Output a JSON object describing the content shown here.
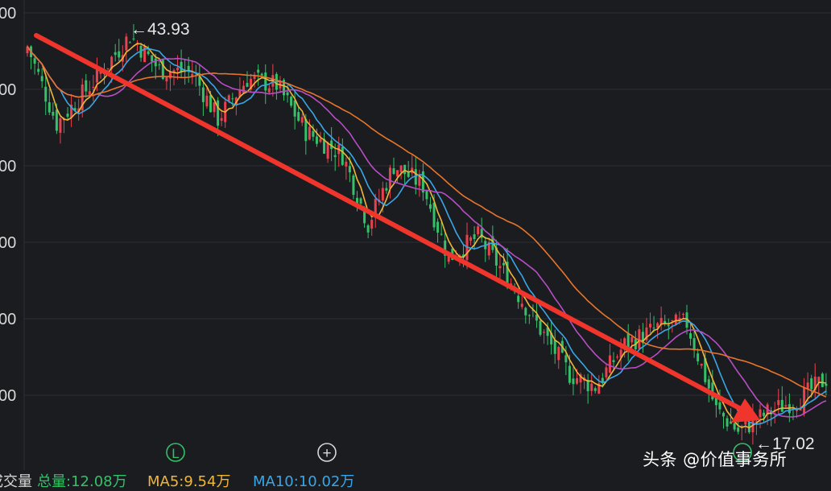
{
  "chart_data": {
    "type": "candlestick",
    "yticks": [
      "00",
      "00",
      "00",
      "00",
      "00",
      "00"
    ],
    "annotations": {
      "high": "←43.93",
      "low": "←17.02"
    },
    "markers": [
      "L",
      "+"
    ],
    "high_value": 43.93,
    "low_value": 17.02,
    "colors": {
      "up": "#e8424e",
      "down": "#35c06a",
      "ma_orange": "#e8752c",
      "ma_yellow": "#f0b63a",
      "ma_blue": "#3aa6e6",
      "ma_purple": "#b84ec4",
      "trend_arrow": "#f0352c"
    }
  },
  "volume_legend": {
    "label": "成交量",
    "total": "总量:12.08万",
    "ma5": "MA5:9.54万",
    "ma10": "MA10:10.02万"
  },
  "watermark": "头条 @价值事务所"
}
